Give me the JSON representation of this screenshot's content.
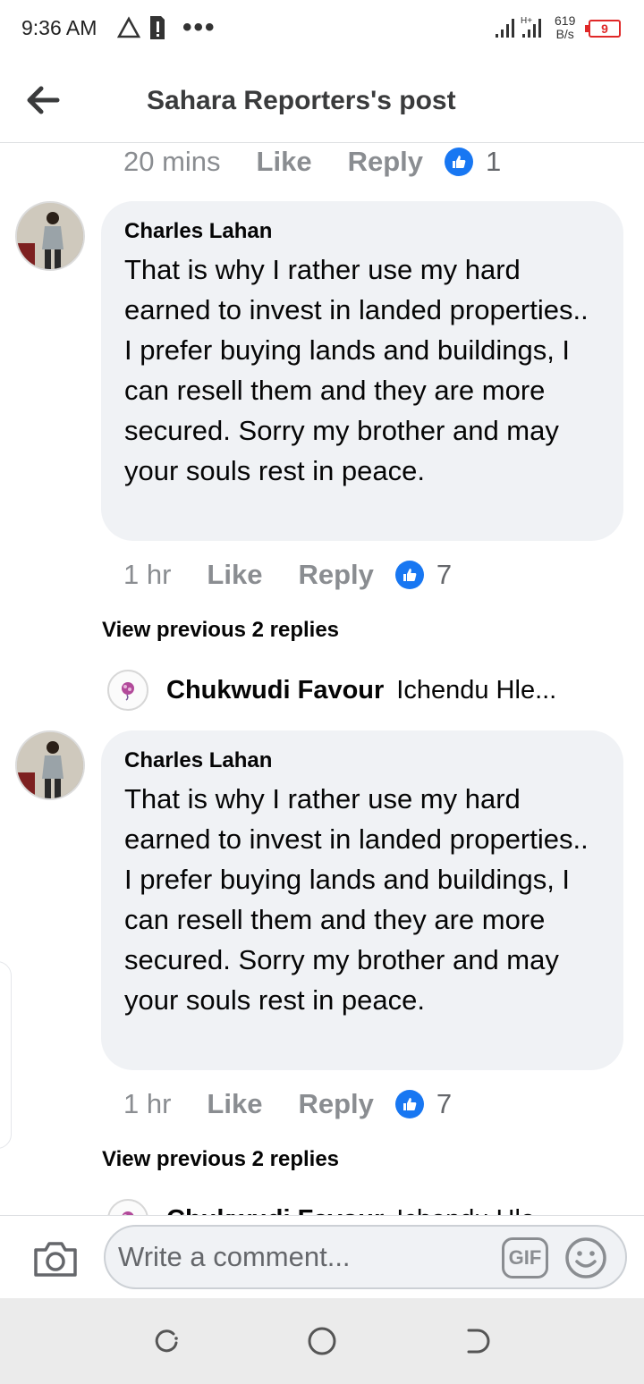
{
  "status": {
    "time": "9:36 AM",
    "net_speed_value": "619",
    "net_speed_unit": "B/s",
    "battery": "9"
  },
  "header": {
    "title": "Sahara Reporters's post",
    "back_icon": "arrow-left-icon"
  },
  "top_meta": {
    "time": "20 mins",
    "like": "Like",
    "reply": "Reply",
    "count": "1"
  },
  "comments": [
    {
      "author": "Charles Lahan",
      "text": "That is why I rather use my hard earned to invest in landed properties..  I prefer buying lands and buildings, I can resell them and they are more secured. Sorry my brother and may your souls rest in peace.",
      "time": "1 hr",
      "like": "Like",
      "reply": "Reply",
      "count": "7",
      "view_replies": "View previous 2 replies",
      "reply_author": "Chukwudi Favour",
      "reply_text": "Ichendu Hle..."
    },
    {
      "author": "Charles Lahan",
      "text": "That is why I rather use my hard earned to invest in landed properties..  I prefer buying lands and buildings, I can resell them and they are more secured. Sorry my brother and may your souls rest in peace.",
      "time": "1 hr",
      "like": "Like",
      "reply": "Reply",
      "count": "7",
      "view_replies": "View previous 2 replies",
      "reply_author": "Chukwudi Favour",
      "reply_text": "Ichendu Hle"
    }
  ],
  "composer": {
    "placeholder": "Write a comment...",
    "gif": "GIF"
  },
  "colors": {
    "accent": "#1877f2",
    "bubble": "#f0f2f5",
    "muted": "#8a8d91"
  }
}
